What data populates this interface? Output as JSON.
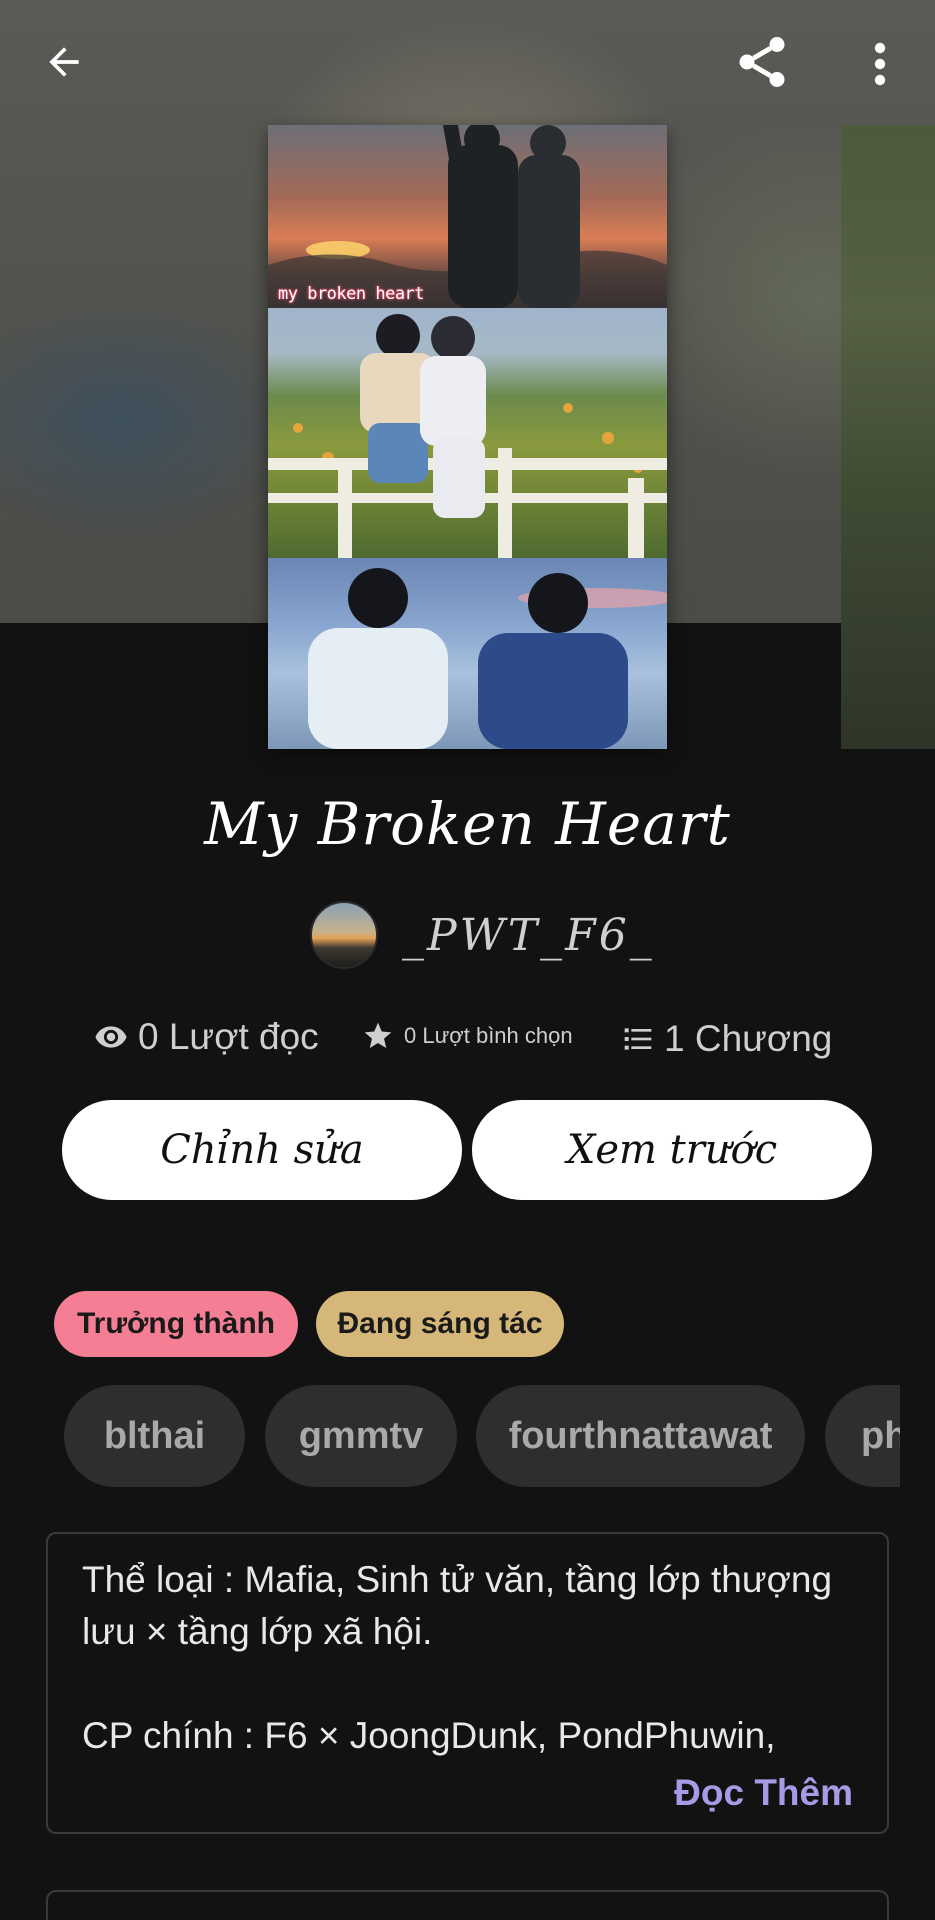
{
  "header": {
    "back_icon": "arrow-left-icon",
    "share_icon": "share-icon",
    "more_icon": "more-vertical-icon"
  },
  "cover": {
    "caption": "my broken heart"
  },
  "story": {
    "title": "My Broken Heart",
    "author": "_PWT_F6_"
  },
  "stats": {
    "reads": "0 Lượt đọc",
    "votes": "0 Lượt bình chọn",
    "chapters": "1 Chương"
  },
  "actions": {
    "edit_label": "Chỉnh sửa",
    "preview_label": "Xem trước"
  },
  "badges": {
    "mature": "Trưởng thành",
    "ongoing": "Đang sáng tác"
  },
  "tags": [
    "blthai",
    "gmmtv",
    "fourthnattawat",
    "ph"
  ],
  "description": {
    "line1": "Thể loại : Mafia, Sinh tử văn, tầng lớp thượng",
    "line2": "lưu × tầng lớp xã hội.",
    "line3": "CP chính : F6 × JoongDunk, PondPhuwin,",
    "read_more": "Đọc Thêm"
  },
  "colors": {
    "background": "#121212",
    "mature_badge": "#f47f95",
    "ongoing_badge": "#d6b77a",
    "read_more": "#a79be6"
  }
}
